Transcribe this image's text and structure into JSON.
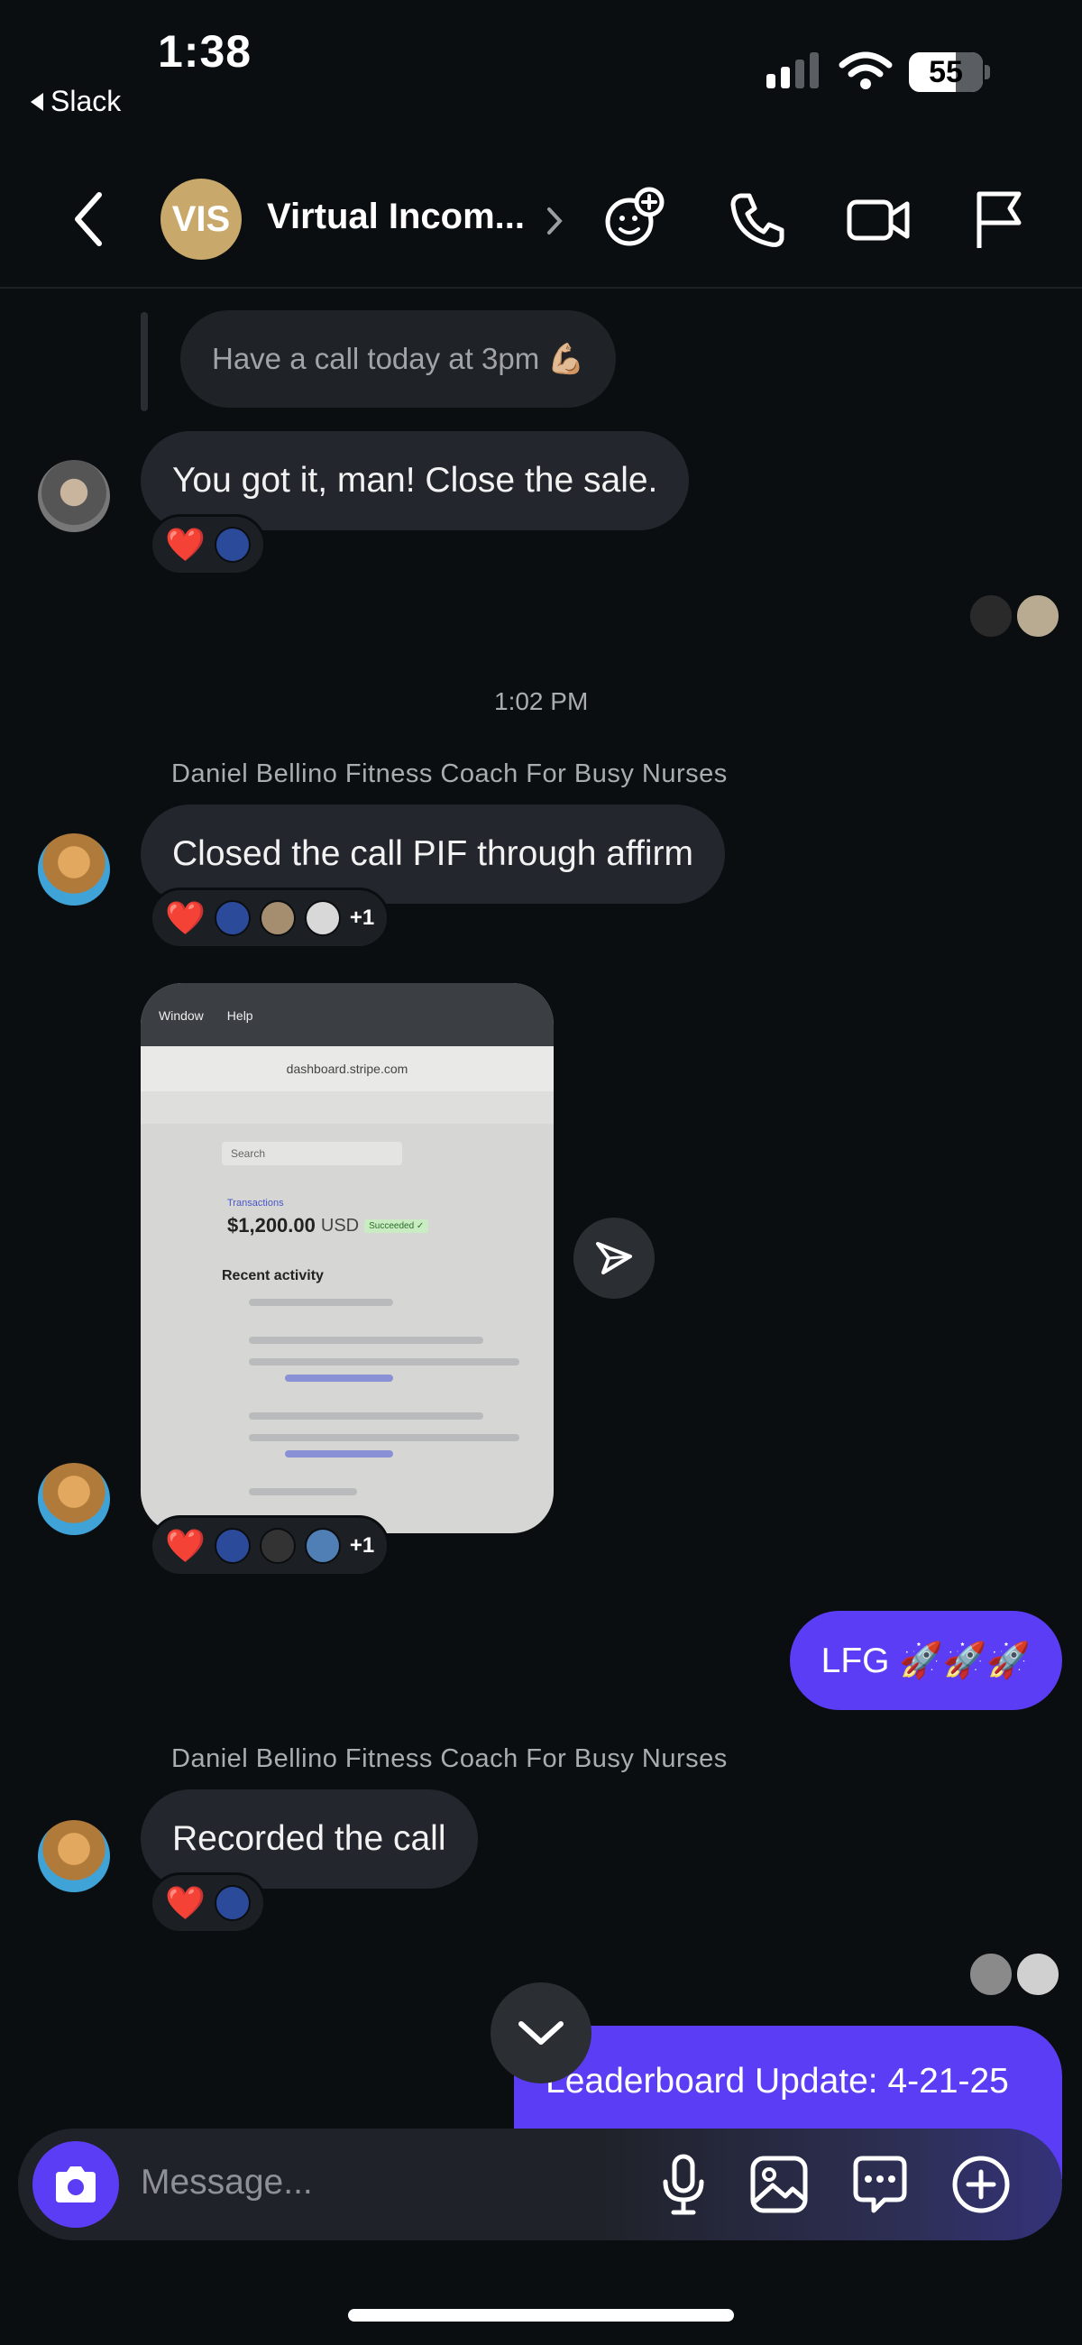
{
  "status_bar": {
    "time": "1:38",
    "back_app": "Slack",
    "battery": "55"
  },
  "header": {
    "channel_initials": "VIS",
    "channel_name": "Virtual Incom..."
  },
  "messages": {
    "quoted_text": "Have a call today at 3pm 💪🏼",
    "msg1": "You got it, man! Close the sale.",
    "timestamp": "1:02 PM",
    "sender1": "Daniel Bellino Fitness Coach For Busy Nurses",
    "msg2": "Closed the call PIF through affirm",
    "msg2_more": "+1",
    "msg3_more": "+1",
    "mine1": "LFG 🚀🚀🚀",
    "sender2": "Daniel Bellino Fitness Coach For Busy Nurses",
    "msg4": "Recorded the call",
    "mine2": "Leaderboard Update: 4-21-25"
  },
  "screenshot": {
    "menu_window": "Window",
    "menu_help": "Help",
    "url": "dashboard.stripe.com",
    "search": "Search",
    "transactions": "Transactions",
    "amount": "$1,200.00",
    "currency": "USD",
    "status": "Succeeded ✓",
    "recent": "Recent activity"
  },
  "reactions": {
    "heart": "❤️"
  },
  "composer": {
    "placeholder": "Message..."
  }
}
